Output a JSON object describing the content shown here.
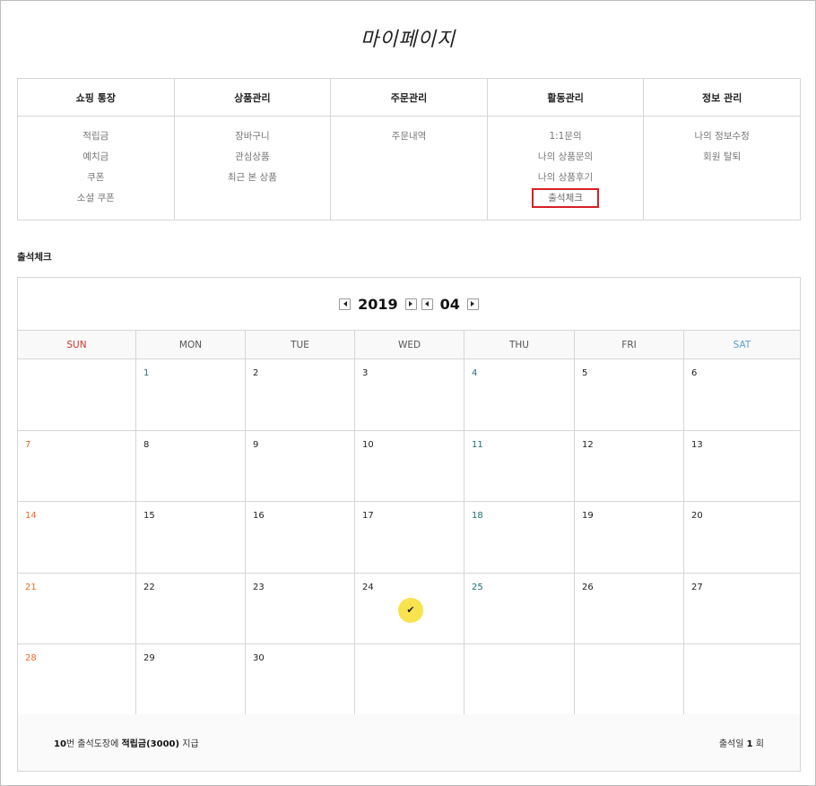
{
  "page_title": "마이페이지",
  "menu": [
    {
      "title": "쇼핑 통장",
      "items": [
        "적립금",
        "예치금",
        "쿠폰",
        "소셜 쿠폰"
      ]
    },
    {
      "title": "상품관리",
      "items": [
        "장바구니",
        "관심상품",
        "최근 본 상품"
      ]
    },
    {
      "title": "주문관리",
      "items": [
        "주문내역"
      ]
    },
    {
      "title": "활동관리",
      "items": [
        "1:1문의",
        "나의 상품문의",
        "나의 상품후기",
        "출석체크"
      ],
      "active_index": 3
    },
    {
      "title": "정보 관리",
      "items": [
        "나의 정보수정",
        "회원 탈퇴"
      ]
    }
  ],
  "section_title": "출석체크",
  "calendar": {
    "year": "2019",
    "month": "04",
    "weekdays": [
      "SUN",
      "MON",
      "TUE",
      "WED",
      "THU",
      "FRI",
      "SAT"
    ],
    "weekday_colors": {
      "sun": "#d0392b",
      "sat": "#5b9bd5"
    },
    "weeks": [
      [
        "",
        "1",
        "2",
        "3",
        "4",
        "5",
        "6"
      ],
      [
        "7",
        "8",
        "9",
        "10",
        "11",
        "12",
        "13"
      ],
      [
        "14",
        "15",
        "16",
        "17",
        "18",
        "19",
        "20"
      ],
      [
        "21",
        "22",
        "23",
        "24",
        "25",
        "26",
        "27"
      ],
      [
        "28",
        "29",
        "30",
        "",
        "",
        "",
        ""
      ]
    ],
    "stamped_day": "24",
    "stamp_icon": "checkmark-icon",
    "stamp_glyph": "✔",
    "stamp_color": "#f8e24e"
  },
  "footer": {
    "reward_count": "10",
    "reward_text": "번 출석도장에 ",
    "reward_bold": "적립금(3000)",
    "reward_suffix": " 지급",
    "attendance_label": "출석일 ",
    "attendance_count": "1",
    "attendance_unit": " 회"
  }
}
